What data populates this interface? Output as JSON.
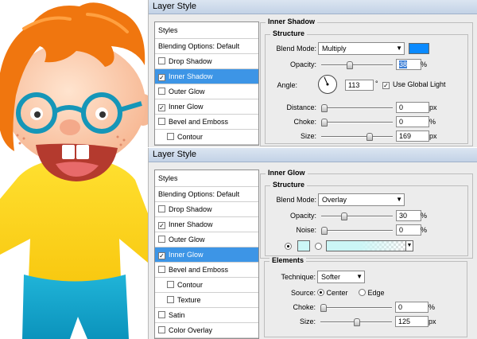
{
  "colors": {
    "inner_shadow_color": "#0a8aff",
    "inner_glow_color": "#cbf6f6",
    "selection": "#3d95e6"
  },
  "panel1": {
    "title": "Layer Style",
    "styles_header": "Styles",
    "styles": [
      {
        "label": "Blending Options: Default",
        "checkbox": false,
        "checked": false,
        "selected": false,
        "indent": false
      },
      {
        "label": "Drop Shadow",
        "checkbox": true,
        "checked": false,
        "selected": false,
        "indent": false
      },
      {
        "label": "Inner Shadow",
        "checkbox": true,
        "checked": true,
        "selected": true,
        "indent": false
      },
      {
        "label": "Outer Glow",
        "checkbox": true,
        "checked": false,
        "selected": false,
        "indent": false
      },
      {
        "label": "Inner Glow",
        "checkbox": true,
        "checked": true,
        "selected": false,
        "indent": false
      },
      {
        "label": "Bevel and Emboss",
        "checkbox": true,
        "checked": false,
        "selected": false,
        "indent": false
      },
      {
        "label": "Contour",
        "checkbox": true,
        "checked": false,
        "selected": false,
        "indent": true
      }
    ],
    "section": "Inner Shadow",
    "structure": "Structure",
    "blend_mode_label": "Blend Mode:",
    "blend_mode": "Multiply",
    "opacity_label": "Opacity:",
    "opacity": "38",
    "opacity_level": 38,
    "angle_label": "Angle:",
    "angle": "113",
    "degree": "°",
    "global_light": "Use Global Light",
    "distance_label": "Distance:",
    "distance": "0",
    "distance_level": 0,
    "choke_label": "Choke:",
    "choke": "0",
    "choke_level": 0,
    "size_label": "Size:",
    "size": "169",
    "size_level": 0.68,
    "pct": "%",
    "px": "px"
  },
  "panel2": {
    "title": "Layer Style",
    "styles_header": "Styles",
    "styles": [
      {
        "label": "Blending Options: Default",
        "checkbox": false,
        "checked": false,
        "selected": false,
        "indent": false
      },
      {
        "label": "Drop Shadow",
        "checkbox": true,
        "checked": false,
        "selected": false,
        "indent": false
      },
      {
        "label": "Inner Shadow",
        "checkbox": true,
        "checked": true,
        "selected": false,
        "indent": false
      },
      {
        "label": "Outer Glow",
        "checkbox": true,
        "checked": false,
        "selected": false,
        "indent": false
      },
      {
        "label": "Inner Glow",
        "checkbox": true,
        "checked": true,
        "selected": true,
        "indent": false
      },
      {
        "label": "Bevel and Emboss",
        "checkbox": true,
        "checked": false,
        "selected": false,
        "indent": false
      },
      {
        "label": "Contour",
        "checkbox": true,
        "checked": false,
        "selected": false,
        "indent": true
      },
      {
        "label": "Texture",
        "checkbox": true,
        "checked": false,
        "selected": false,
        "indent": true
      },
      {
        "label": "Satin",
        "checkbox": true,
        "checked": false,
        "selected": false,
        "indent": false
      },
      {
        "label": "Color Overlay",
        "checkbox": true,
        "checked": false,
        "selected": false,
        "indent": false
      }
    ],
    "section": "Inner Glow",
    "structure": "Structure",
    "blend_mode_label": "Blend Mode:",
    "blend_mode": "Overlay",
    "opacity_label": "Opacity:",
    "opacity": "30",
    "opacity_level": 30,
    "noise_label": "Noise:",
    "noise": "0",
    "noise_level": 0,
    "elements": "Elements",
    "technique_label": "Technique:",
    "technique": "Softer",
    "source_label": "Source:",
    "center": "Center",
    "edge": "Edge",
    "choke_label": "Choke:",
    "choke": "0",
    "choke_level": 0,
    "size_label": "Size:",
    "size": "125",
    "size_level": 0.5,
    "pct": "%",
    "px": "px"
  }
}
